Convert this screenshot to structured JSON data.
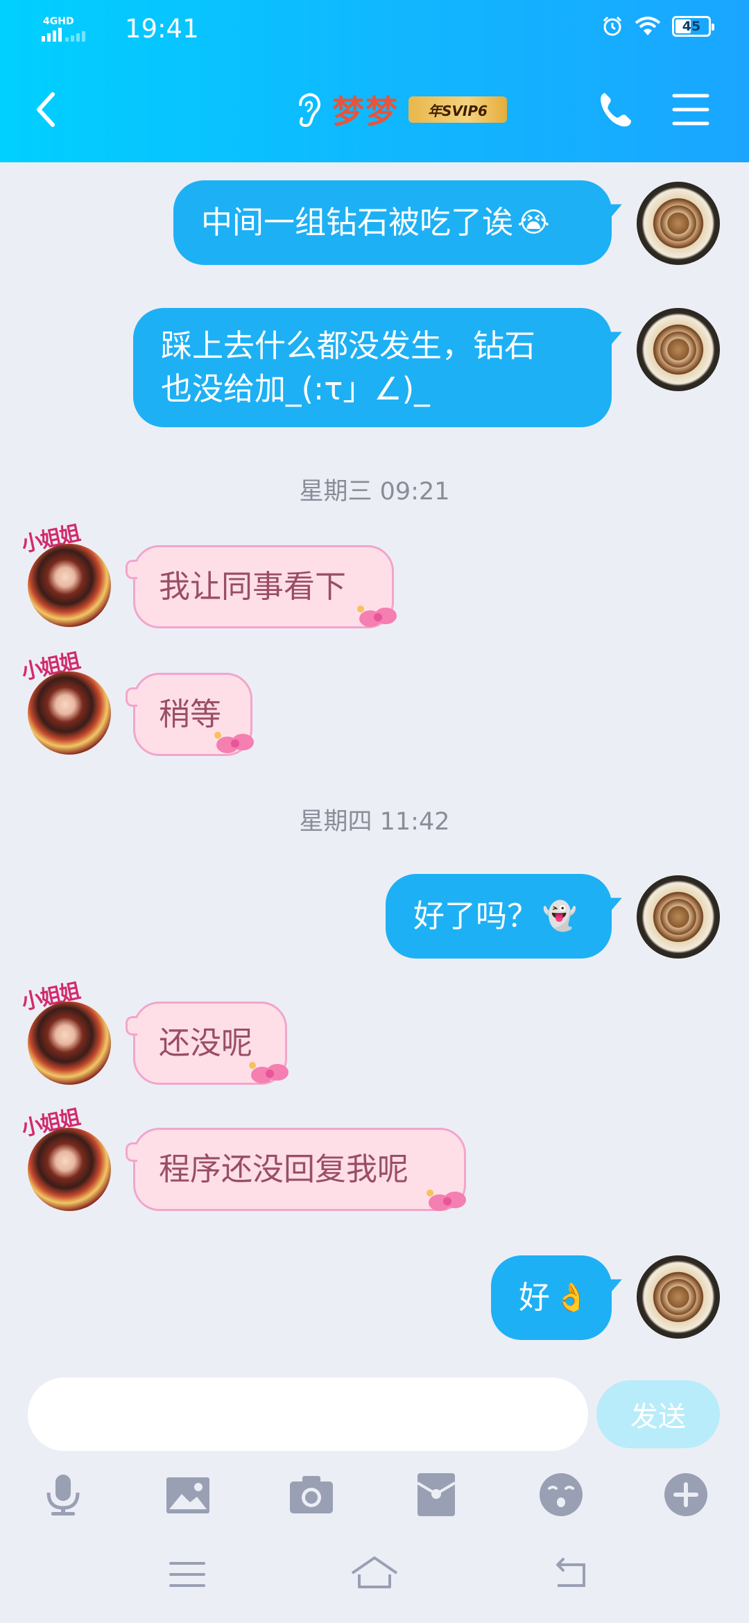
{
  "status_bar": {
    "network": "4GHD",
    "time": "19:41",
    "battery": "45"
  },
  "header": {
    "title": "梦梦",
    "badge": "年SVIP6"
  },
  "messages": [
    {
      "side": "out",
      "text": "中间一组钻石被吃了诶",
      "emoji": "😭"
    },
    {
      "side": "out",
      "line1": "踩上去什么都没发生，钻石",
      "line2": "也没给加_(:τ」∠)_"
    },
    {
      "type": "time",
      "text": "星期三 09:21"
    },
    {
      "side": "in",
      "text": "我让同事看下"
    },
    {
      "side": "in",
      "text": "稍等"
    },
    {
      "type": "time",
      "text": "星期四 11:42"
    },
    {
      "side": "out",
      "text": "好了吗？",
      "emoji": "👻"
    },
    {
      "side": "in",
      "text": "还没呢"
    },
    {
      "side": "in",
      "text": "程序还没回复我呢"
    },
    {
      "side": "out",
      "text": "好",
      "emoji": "👌"
    }
  ],
  "sticker_text": "小姐姐",
  "input": {
    "placeholder": "",
    "send_label": "发送"
  },
  "toolbar": [
    "microphone-icon",
    "image-icon",
    "camera-icon",
    "red-packet-icon",
    "emoji-icon",
    "plus-icon"
  ],
  "colors": {
    "header_start": "#00d0ff",
    "header_end": "#1aa6ff",
    "bubble_out": "#1eb0f4",
    "bubble_in": "#ffdfe7",
    "title": "#e8543a"
  }
}
